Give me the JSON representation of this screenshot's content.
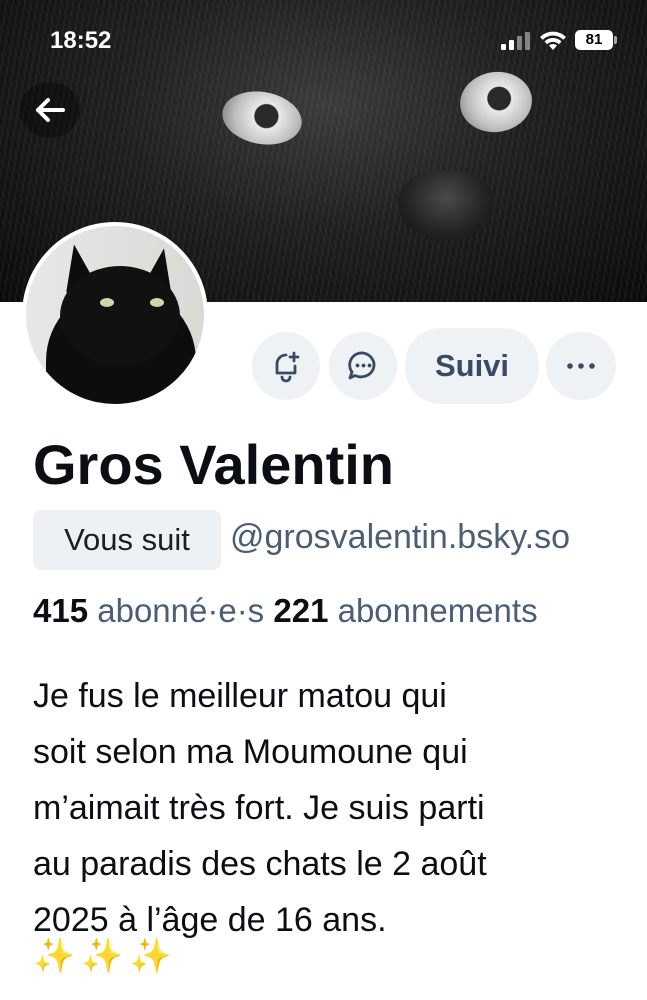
{
  "status_bar": {
    "time": "18:52",
    "battery": "81"
  },
  "header": {
    "back_icon": "arrow-left-icon"
  },
  "actions": {
    "subscribe_icon": "bell-plus-icon",
    "message_icon": "chat-bubble-icon",
    "follow_label": "Suivi",
    "more_icon": "ellipsis-icon"
  },
  "profile": {
    "display_name": "Gros Valentin",
    "follows_you_badge": "Vous suit",
    "handle": "@grosvalentin.bsky.so",
    "followers_count": "415",
    "followers_label": "abonné·e·s",
    "following_count": "221",
    "following_label": "abonnements",
    "bio_lines": [
      "Je fus le meilleur matou qui",
      "soit selon ma Moumoune qui",
      "m’aimait très fort. Je suis parti",
      "au paradis des chats le 2 août",
      "2025 à l’âge de 16 ans."
    ],
    "bio_emoji": "✨✨✨"
  },
  "colors": {
    "accent_text": "#3a4a62",
    "muted_text": "#4b5e76",
    "button_bg": "#eef2f5",
    "sparkle": "#f2c230"
  }
}
